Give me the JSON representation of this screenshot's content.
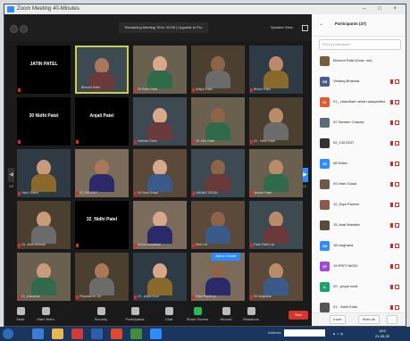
{
  "window": {
    "title": "Zoom Meeting 40-Minutes",
    "controls": "– □ ×"
  },
  "meeting": {
    "banner": "Remaining Meeting Time: 09:53 | Upgrade to Pro",
    "view_label": "Speaker View"
  },
  "pager": {
    "left": "1/2",
    "right": "1/2"
  },
  "tiles": [
    {
      "name": "",
      "big_name": "JATIN PATEL",
      "muted": true,
      "video": false
    },
    {
      "name": "Bhoomi Patel",
      "big_name": "",
      "muted": false,
      "video": true,
      "active": true
    },
    {
      "name": "20 Parth Patel",
      "big_name": "",
      "muted": true,
      "video": true
    },
    {
      "name": "Aditya Patel",
      "big_name": "",
      "muted": true,
      "video": true
    },
    {
      "name": "Bhumi Patel",
      "big_name": "",
      "muted": true,
      "video": true
    },
    {
      "name": "",
      "big_name": "30 Nidhi Patel",
      "muted": true,
      "video": false
    },
    {
      "name": "",
      "big_name": "Anjali Patel",
      "muted": true,
      "video": false
    },
    {
      "name": "Vaibhav Shah",
      "big_name": "",
      "muted": true,
      "video": true
    },
    {
      "name": "15 -Ritu Patel",
      "big_name": "",
      "muted": true,
      "video": true
    },
    {
      "name": "24 - Hetul Patel",
      "big_name": "",
      "muted": true,
      "video": true
    },
    {
      "name": "Yash Chand",
      "big_name": "",
      "muted": true,
      "video": true
    },
    {
      "name": "02_EM DDIT",
      "big_name": "",
      "muted": true,
      "video": true
    },
    {
      "name": "09-Yash Gosai",
      "big_name": "",
      "muted": true,
      "video": true
    },
    {
      "name": "UMANG DESAI",
      "big_name": "",
      "muted": true,
      "video": true
    },
    {
      "name": "Jeevan Patel",
      "big_name": "",
      "muted": true,
      "video": true
    },
    {
      "name": "15- Jinal Mahetta",
      "big_name": "",
      "muted": true,
      "video": true
    },
    {
      "name": "",
      "big_name": "32_Nidhi Patel",
      "muted": true,
      "video": false
    },
    {
      "name": "Vishal chaudhari",
      "big_name": "",
      "muted": true,
      "video": true
    },
    {
      "name": "Neel Lal",
      "big_name": "",
      "muted": true,
      "video": true
    },
    {
      "name": "Patel Parth Lal",
      "big_name": "",
      "muted": true,
      "video": true
    },
    {
      "name": "01_chaudhari",
      "big_name": "",
      "muted": true,
      "video": true
    },
    {
      "name": "Priyanka M. Dh",
      "big_name": "",
      "muted": true,
      "video": true
    },
    {
      "name": "20 - priyal modi",
      "big_name": "",
      "muted": true,
      "video": true
    },
    {
      "name": "Patel Riddhi ja",
      "big_name": "",
      "muted": true,
      "video": true
    },
    {
      "name": "30 meghana",
      "big_name": "",
      "muted": true,
      "video": true
    }
  ],
  "tooltip": "Ask to Unmute",
  "toolbar": {
    "mute": "Mute",
    "video": "Start Video",
    "security": "Security",
    "participants": "Participants",
    "participants_count": "47",
    "chat": "Chat",
    "share": "Share Screen",
    "record": "Record",
    "reactions": "Reactions",
    "end": "End"
  },
  "panel": {
    "title": "Participants (47)",
    "search_placeholder": "Find a participant",
    "invite": "Invite",
    "mute_all": "Mute All",
    "more": "...",
    "participants": [
      {
        "initials": "",
        "name": "Bhoomi Patel (Host, me)",
        "color": "#7a5b3b",
        "photo": true
      },
      {
        "initials": "VB",
        "name": "Vedang Bhavsar",
        "color": "#4a5b8a"
      },
      {
        "initials": "01",
        "name": "01_ chaudhari nehal narayanbhai",
        "color": "#e05a2e"
      },
      {
        "initials": "",
        "name": "02 Sameer Chavda",
        "color": "#5b6b7a",
        "photo": true
      },
      {
        "initials": "",
        "name": "02_CM DDIT",
        "color": "#333333",
        "photo": true
      },
      {
        "initials": "08",
        "name": "08 Divita",
        "color": "#2d8cff"
      },
      {
        "initials": "",
        "name": "09-Yash Gosai",
        "color": "#6b5a48",
        "photo": true
      },
      {
        "initials": "",
        "name": "12_Diya Parmar",
        "color": "#8a5a4a",
        "photo": true
      },
      {
        "initials": "",
        "name": "15-Jinal Mahetta",
        "color": "#5a4a3a",
        "photo": true
      },
      {
        "initials": "1M",
        "name": "18 meghana",
        "color": "#2d8cff"
      },
      {
        "initials": "1P",
        "name": "19 PRITI MODI",
        "color": "#9b4bd6"
      },
      {
        "initials": "2-",
        "name": "20 - priyal modi",
        "color": "#1aa36b"
      },
      {
        "initials": "",
        "name": "21 - Sahil Khan",
        "color": "#555555",
        "photo": true
      }
    ]
  },
  "taskbar": {
    "address_label": "Address",
    "time": "18:0",
    "date": "21-05-20"
  }
}
